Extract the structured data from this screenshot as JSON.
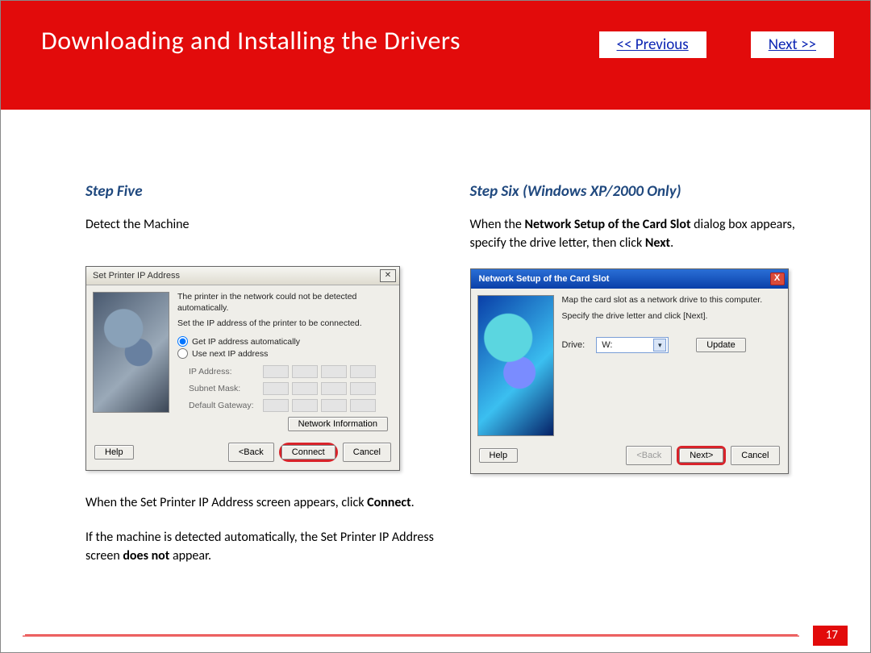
{
  "header": {
    "title": "Downloading and Installing  the Drivers",
    "prev_label": "<< Previous",
    "next_label": "Next >>"
  },
  "left": {
    "step_title": "Step Five",
    "intro": "Detect the Machine",
    "dialog": {
      "title": "Set Printer IP Address",
      "line1": "The printer in the network could not be detected automatically.",
      "line2": "Set the IP address of the printer to be connected.",
      "radio1": "Get IP address automatically",
      "radio2": "Use next IP address",
      "field_ip": "IP Address:",
      "field_mask": "Subnet Mask:",
      "field_gw": "Default Gateway:",
      "netinfo_btn": "Network Information",
      "help_btn": "Help",
      "back_btn": "<Back",
      "connect_btn": "Connect",
      "cancel_btn": "Cancel"
    },
    "after1_a": "When the Set Printer IP Address screen appears, click ",
    "after1_b": "Connect",
    "after1_c": ".",
    "after2_a": "If the machine is detected automatically, the Set Printer IP Address screen ",
    "after2_b": "does not",
    "after2_c": " appear."
  },
  "right": {
    "step_title": "Step Six (Windows XP/2000 Only)",
    "intro_a": "When the ",
    "intro_b": "Network Setup of the Card Slot",
    "intro_c": " dialog box appears, specify the drive letter, then click ",
    "intro_d": "Next",
    "intro_e": ".",
    "dialog": {
      "title": "Network Setup of the Card Slot",
      "line1": "Map the card slot as a network drive to this computer.",
      "line2": "Specify the drive letter and click [Next].",
      "drive_label": "Drive:",
      "drive_value": "W:",
      "update_btn": "Update",
      "help_btn": "Help",
      "back_btn": "<Back",
      "next_btn": "Next>",
      "cancel_btn": "Cancel"
    }
  },
  "page_number": "17"
}
